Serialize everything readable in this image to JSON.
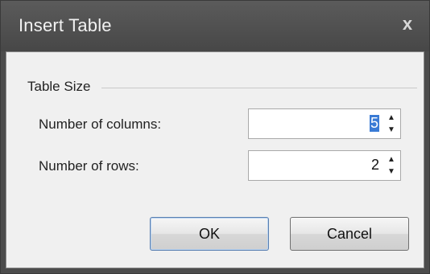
{
  "window": {
    "title": "Insert Table",
    "close_glyph": "x"
  },
  "group": {
    "label": "Table Size"
  },
  "fields": [
    {
      "label": "Number of columns:",
      "value": "5",
      "up": "▲",
      "down": "▼"
    },
    {
      "label": "Number of rows:",
      "value": "2",
      "up": "▲",
      "down": "▼"
    }
  ],
  "buttons": {
    "ok": "OK",
    "cancel": "Cancel"
  },
  "colors": {
    "titlebar": "#4c4c4c",
    "client": "#f0f0f0",
    "selection": "#3a7bd5"
  }
}
